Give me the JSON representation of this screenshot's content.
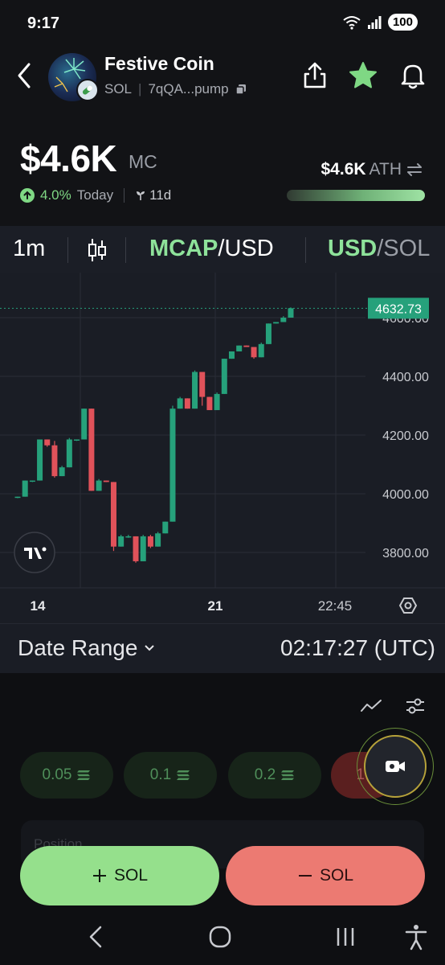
{
  "status_bar": {
    "time": "9:17",
    "battery": "100",
    "wifi_icon": "wifi-6-icon",
    "signal_icon": "signal-icon"
  },
  "header": {
    "token_name": "Festive Coin",
    "chain": "SOL",
    "address": "7qQA...pump",
    "icons": [
      "back-icon",
      "share-icon",
      "star-icon",
      "bell-icon",
      "copy-icon"
    ]
  },
  "market": {
    "mc_value": "$4.6K",
    "mc_unit": "MC",
    "change_pct": "4.0%",
    "change_label": "Today",
    "age": "11d",
    "ath_value": "$4.6K",
    "ath_label": "ATH",
    "ath_progress": 1.0
  },
  "toolbar": {
    "interval": "1m",
    "mcap_primary": "MCAP",
    "mcap_secondary": "/USD",
    "usd_primary": "USD",
    "usd_secondary": "/SOL"
  },
  "chart_data": {
    "type": "candlestick",
    "y_ticks": [
      "4000.00",
      "4200.00",
      "4400.00",
      "3800.00"
    ],
    "y_tick_values": [
      4600,
      4400,
      4200,
      4000,
      3800
    ],
    "x_ticks": [
      "14",
      "21",
      "22:45"
    ],
    "last_price": "4632.73",
    "ylim": [
      3700,
      4750
    ],
    "candles": [
      {
        "o": 3990,
        "h": 3990,
        "l": 3985,
        "c": 3990
      },
      {
        "o": 3990,
        "h": 4045,
        "l": 3990,
        "c": 4045
      },
      {
        "o": 4045,
        "h": 4045,
        "l": 4040,
        "c": 4045
      },
      {
        "o": 4045,
        "h": 4185,
        "l": 4045,
        "c": 4185
      },
      {
        "o": 4185,
        "h": 4185,
        "l": 4160,
        "c": 4165
      },
      {
        "o": 4165,
        "h": 4180,
        "l": 4055,
        "c": 4060
      },
      {
        "o": 4060,
        "h": 4095,
        "l": 4060,
        "c": 4090
      },
      {
        "o": 4090,
        "h": 4190,
        "l": 4090,
        "c": 4185
      },
      {
        "o": 4185,
        "h": 4185,
        "l": 4180,
        "c": 4185
      },
      {
        "o": 4185,
        "h": 4290,
        "l": 4185,
        "c": 4290
      },
      {
        "o": 4290,
        "h": 4290,
        "l": 4010,
        "c": 4010
      },
      {
        "o": 4010,
        "h": 4050,
        "l": 4010,
        "c": 4045
      },
      {
        "o": 4045,
        "h": 4045,
        "l": 4040,
        "c": 4040
      },
      {
        "o": 4040,
        "h": 4040,
        "l": 3805,
        "c": 3820
      },
      {
        "o": 3820,
        "h": 3860,
        "l": 3820,
        "c": 3855
      },
      {
        "o": 3855,
        "h": 3860,
        "l": 3850,
        "c": 3855
      },
      {
        "o": 3855,
        "h": 3855,
        "l": 3765,
        "c": 3770
      },
      {
        "o": 3770,
        "h": 3860,
        "l": 3770,
        "c": 3855
      },
      {
        "o": 3855,
        "h": 3860,
        "l": 3815,
        "c": 3820
      },
      {
        "o": 3820,
        "h": 3870,
        "l": 3820,
        "c": 3865
      },
      {
        "o": 3865,
        "h": 3905,
        "l": 3865,
        "c": 3905
      },
      {
        "o": 3905,
        "h": 4300,
        "l": 3905,
        "c": 4290
      },
      {
        "o": 4290,
        "h": 4330,
        "l": 4290,
        "c": 4325
      },
      {
        "o": 4325,
        "h": 4325,
        "l": 4290,
        "c": 4290
      },
      {
        "o": 4290,
        "h": 4420,
        "l": 4290,
        "c": 4415
      },
      {
        "o": 4415,
        "h": 4415,
        "l": 4300,
        "c": 4330
      },
      {
        "o": 4330,
        "h": 4330,
        "l": 4285,
        "c": 4285
      },
      {
        "o": 4285,
        "h": 4345,
        "l": 4285,
        "c": 4340
      },
      {
        "o": 4340,
        "h": 4460,
        "l": 4340,
        "c": 4460
      },
      {
        "o": 4460,
        "h": 4485,
        "l": 4460,
        "c": 4485
      },
      {
        "o": 4485,
        "h": 4505,
        "l": 4485,
        "c": 4505
      },
      {
        "o": 4505,
        "h": 4505,
        "l": 4500,
        "c": 4500
      },
      {
        "o": 4500,
        "h": 4500,
        "l": 4460,
        "c": 4465
      },
      {
        "o": 4465,
        "h": 4515,
        "l": 4465,
        "c": 4510
      },
      {
        "o": 4510,
        "h": 4580,
        "l": 4510,
        "c": 4580
      },
      {
        "o": 4580,
        "h": 4585,
        "l": 4580,
        "c": 4585
      },
      {
        "o": 4585,
        "h": 4605,
        "l": 4585,
        "c": 4600
      },
      {
        "o": 4600,
        "h": 4635,
        "l": 4600,
        "c": 4632
      }
    ],
    "up_color": "#26a17b",
    "down_color": "#e0525a"
  },
  "range_row": {
    "label": "Date Range",
    "time": "02:17:27 (UTC)"
  },
  "amounts": [
    {
      "label": "0.05"
    },
    {
      "label": "0.1"
    },
    {
      "label": "0.2"
    },
    {
      "label": "1("
    }
  ],
  "position_label": "Position",
  "actions": {
    "buy_label": "SOL",
    "sell_label": "SOL"
  },
  "colors": {
    "accent_green": "#8ee29a",
    "buy": "#95e08c",
    "sell": "#ec7a72",
    "background": "#121316"
  }
}
